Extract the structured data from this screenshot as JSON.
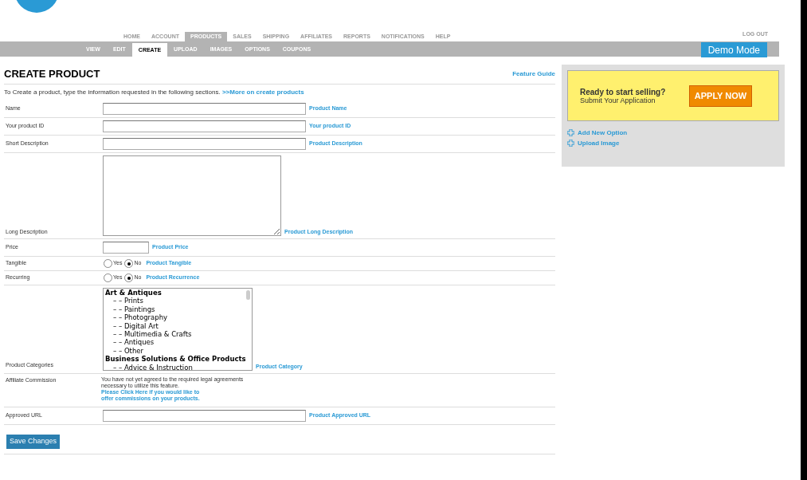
{
  "nav": {
    "items": [
      {
        "label": "HOME",
        "selected": false
      },
      {
        "label": "ACCOUNT",
        "selected": false
      },
      {
        "label": "PRODUCTS",
        "selected": true
      },
      {
        "label": "SALES",
        "selected": false
      },
      {
        "label": "SHIPPING",
        "selected": false
      },
      {
        "label": "AFFILIATES",
        "selected": false
      },
      {
        "label": "REPORTS",
        "selected": false
      },
      {
        "label": "NOTIFICATIONS",
        "selected": false
      },
      {
        "label": "HELP",
        "selected": false
      }
    ],
    "logout": "LOG OUT"
  },
  "subnav": {
    "items": [
      {
        "label": "VIEW",
        "selected": false
      },
      {
        "label": "EDIT",
        "selected": false
      },
      {
        "label": "CREATE",
        "selected": true
      },
      {
        "label": "UPLOAD",
        "selected": false
      },
      {
        "label": "IMAGES",
        "selected": false
      },
      {
        "label": "OPTIONS",
        "selected": false
      },
      {
        "label": "COUPONS",
        "selected": false
      }
    ],
    "mode": "Demo Mode"
  },
  "page": {
    "title": "CREATE PRODUCT",
    "guide": "Feature Guide",
    "intro": "To Create a product, type the information requested in the following sections.",
    "intro_link": ">>More on create products"
  },
  "form": [
    {
      "kind": "text",
      "label": "Name",
      "help": "Product Name"
    },
    {
      "kind": "text",
      "label": "Your product ID",
      "help": "Your product ID"
    },
    {
      "kind": "text",
      "label": "Short Description",
      "help": "Product Description"
    },
    {
      "kind": "textarea",
      "label": "Long Description",
      "help": "Product Long Description"
    },
    {
      "kind": "short",
      "label": "Price",
      "help": "Product Price"
    },
    {
      "kind": "radio",
      "label": "Tangible",
      "help": "Product Tangible",
      "options": [
        {
          "label": "Yes",
          "selected": false
        },
        {
          "label": "No",
          "selected": true
        }
      ]
    },
    {
      "kind": "radio",
      "label": "Recurring",
      "help": "Product Recurrence",
      "options": [
        {
          "label": "Yes",
          "selected": false
        },
        {
          "label": "No",
          "selected": true
        }
      ]
    },
    {
      "kind": "list",
      "label": "Product Categories",
      "help": "Product Category",
      "options": [
        {
          "label": "Art & Antiques",
          "children": [
            {
              "label": "– – Prints"
            },
            {
              "label": "– – Paintings"
            },
            {
              "label": "– – Photography"
            },
            {
              "label": "– – Digital Art"
            },
            {
              "label": "– – Multimedia & Crafts"
            },
            {
              "label": "– – Antiques"
            },
            {
              "label": "– – Other"
            }
          ]
        },
        {
          "label": "Business Solutions & Office Products",
          "children": [
            {
              "label": "– – Advice & Instruction"
            }
          ]
        }
      ]
    },
    {
      "kind": "note",
      "label": "Affiliate Commission",
      "note": "You have not yet agreed to the required legal agreements necessary to utilize this feature.",
      "link": "Please Click Here if you would like to offer commissions on your products."
    },
    {
      "kind": "text",
      "label": "Approved URL",
      "help": "Product Approved URL"
    }
  ],
  "save": "Save Changes",
  "sidebar": {
    "heading": "Ready to start selling?",
    "subheading": "Submit Your Application",
    "apply": "APPLY NOW",
    "links": [
      "Add New Option",
      "Upload Image"
    ]
  }
}
